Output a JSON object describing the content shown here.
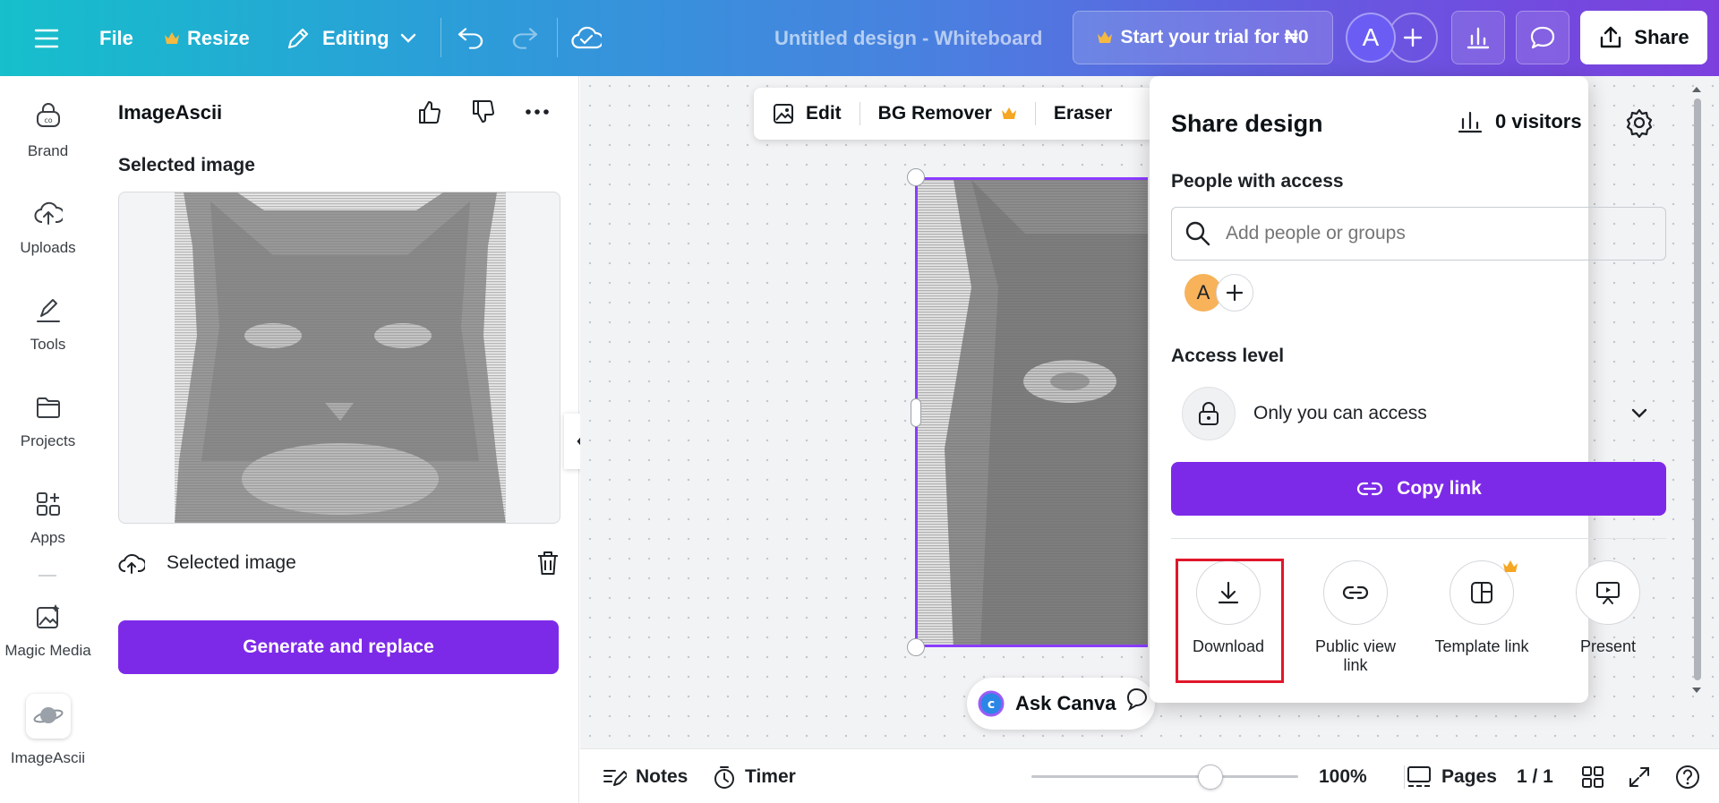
{
  "topbar": {
    "file": "File",
    "resize": "Resize",
    "editing": "Editing",
    "doc_title": "Untitled design - Whiteboard",
    "trial": "Start your trial for ₦0",
    "avatar": "A",
    "share": "Share"
  },
  "leftnav": {
    "items": [
      {
        "label": "Brand",
        "icon": "brand-icon"
      },
      {
        "label": "Uploads",
        "icon": "upload-cloud-icon"
      },
      {
        "label": "Tools",
        "icon": "tools-icon"
      },
      {
        "label": "Projects",
        "icon": "folder-icon"
      },
      {
        "label": "Apps",
        "icon": "apps-icon"
      },
      {
        "label": "Magic Media",
        "icon": "magic-media-icon"
      },
      {
        "label": "ImageAscii",
        "icon": "imageascii-app-icon"
      }
    ]
  },
  "panel": {
    "title": "ImageAscii",
    "selected_heading": "Selected image",
    "selected_row": "Selected image",
    "generate": "Generate and replace"
  },
  "canvas": {
    "ctx_edit": "Edit",
    "ctx_bg_remover": "BG Remover",
    "ctx_eraser": "Eraser",
    "ask_canva": "Ask Canva"
  },
  "bottombar": {
    "notes": "Notes",
    "timer": "Timer",
    "zoom": "100%",
    "zoom_fraction": 0.67,
    "pages": "Pages",
    "page_count": "1 / 1"
  },
  "share": {
    "title": "Share design",
    "visitors": "0 visitors",
    "people_label": "People with access",
    "search_placeholder": "Add people or groups",
    "avatar": "A",
    "access_label": "Access level",
    "access_value": "Only you can access",
    "copy_link": "Copy link",
    "options": [
      {
        "label": "Download",
        "icon": "download-icon"
      },
      {
        "label": "Public view link",
        "icon": "link-icon"
      },
      {
        "label": "Template link",
        "icon": "template-icon"
      },
      {
        "label": "Present",
        "icon": "present-icon"
      }
    ]
  },
  "colors": {
    "accent": "#7d2ae8",
    "selection": "#8b3dff",
    "highlight": "#e0162b",
    "crown": "#f5a623"
  }
}
